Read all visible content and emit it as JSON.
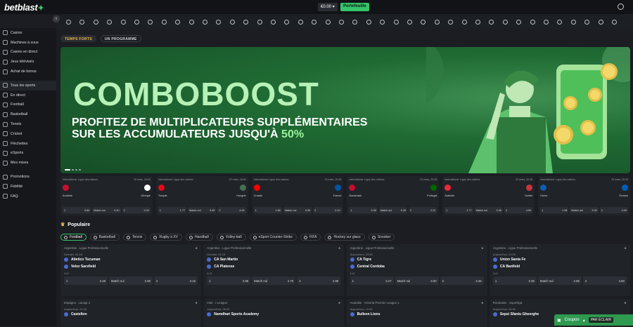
{
  "header": {
    "logo": "betblast",
    "balance": "€0.00",
    "wallet_label": "Portefeuille"
  },
  "sidebar": {
    "casino": [
      "Casino",
      "Machines à sous",
      "Casino en direct",
      "Jeux télévisés",
      "Achat de bonus"
    ],
    "sports": [
      "Tous les sports",
      "En direct",
      "Football",
      "Basketball",
      "Tennis",
      "Cricket",
      "Fléchettes",
      "eSports",
      "Mes mises"
    ],
    "other": [
      "Promotions",
      "Fidélité",
      "FAQ"
    ]
  },
  "tabs": [
    "TEMPS FORTS",
    "UN PROGRAMME"
  ],
  "banner": {
    "title": "COMBOBOOST",
    "line1": "PROFITEZ DE MULTIPLICATEURS SUPPLÉMENTAIRES",
    "line2": "SUR LES ACCUMULATEURS JUSQU'À ",
    "highlight": "50%"
  },
  "matches": [
    {
      "league": "International. Ligue des nations",
      "time": "20 mars, 18:00",
      "home": "Arménie",
      "away": "Géorgie",
      "o1": "3.80",
      "ox": "3.40",
      "o2": "2.02",
      "c1": "#c8102e",
      "c2": "#ffffff"
    },
    {
      "league": "International. Ligue des nations",
      "time": "20 mars, 18:00",
      "home": "Turquie",
      "away": "Hongrie",
      "o1": "1.77",
      "ox": "3.45",
      "o2": "4.00",
      "c1": "#e30a17",
      "c2": "#477050"
    },
    {
      "league": "International. Ligue des nations",
      "time": "20 mars, 20:45",
      "home": "Croatie",
      "away": "France",
      "o1": "2.80",
      "ox": "3.30",
      "o2": "2.10",
      "c1": "#ff0000",
      "c2": "#0055a4"
    },
    {
      "league": "International. Ligue des nations",
      "time": "20 mars, 20:45",
      "home": "Danemark",
      "away": "Portugal",
      "o1": "3.35",
      "ox": "3.25",
      "o2": "2.22",
      "c1": "#c60c30",
      "c2": "#006600"
    },
    {
      "league": "International. Ligue des nations",
      "time": "20 mars, 20:45",
      "home": "Autriche",
      "away": "Serbie",
      "o1": "1.77",
      "ox": "3.45",
      "o2": "4.90",
      "c1": "#ed2939",
      "c2": "#c6363c"
    },
    {
      "league": "International. Ligue des nations",
      "time": "20 mars, 20:45",
      "home": "Grèce",
      "away": "Écosse",
      "o1": "1.98",
      "ox": "3.30",
      "o2": "4.00",
      "c1": "#0d5eaf",
      "c2": "#005eb8"
    }
  ],
  "match_labels": {
    "draw": "Match nul",
    "one": "1",
    "two": "2"
  },
  "popular": {
    "title": "Populaire",
    "filters": [
      "Football",
      "Basketball",
      "Tennis",
      "Rugby à XV",
      "Handball",
      "Volley-ball",
      "eSport Counter-Strike",
      "FIFA",
      "Hockey sur glace",
      "Snooker"
    ]
  },
  "events": [
    {
      "league": "Argentine . Ligue Professionnelle",
      "time": "Demain, 01:15",
      "home": "Atletico Tucuman",
      "away": "Velez Sarsfield",
      "market": "1×2",
      "o1": "2.48",
      "ox": "2.85",
      "o2": "3.15"
    },
    {
      "league": "Argentine . Ligue Professionnelle",
      "time": "Demain, 01:15",
      "home": "CA San Martin",
      "away": "CA Platense",
      "market": "1×2",
      "o1": "2.85",
      "ox": "2.70",
      "o2": "2.90"
    },
    {
      "league": "Argentine . Ligue Professionnelle",
      "time": "Aujourd'hui, 23:00",
      "home": "CA Tigre",
      "away": "Central Cordoba",
      "market": "1×2",
      "o1": "2.27",
      "ox": "3.00",
      "o2": "3.45"
    },
    {
      "league": "Argentine . Ligue Professionnelle",
      "time": "Aujourd'hui, 23:00",
      "home": "Union Santa Fe",
      "away": "CA Banfield",
      "market": "1×2",
      "o1": "2.05",
      "ox": "2.85",
      "o2": "4.60"
    },
    {
      "league": "Espagne . LaLiga 2",
      "time": "Aujourd'hui, 21:00",
      "home": "Castellon",
      "away": "",
      "market": "",
      "o1": "",
      "ox": "",
      "o2": ""
    },
    {
      "league": "Inde . I-League",
      "time": "Aujourd'hui, 09:00",
      "home": "Namdhari Sports Academy",
      "away": "",
      "market": "",
      "o1": "",
      "ox": "",
      "o2": ""
    },
    {
      "league": "Australie . Victoria Premier League 1",
      "time": "Aujourd'hui, 10:30",
      "home": "Bulleen Lions",
      "away": "",
      "market": "",
      "o1": "",
      "ox": "",
      "o2": ""
    },
    {
      "league": "Roumanie . Superliga",
      "time": "Aujourd'hui, 18:00",
      "home": "Sepsi Sfantu Gheorghe",
      "away": "",
      "market": "",
      "o1": "",
      "ox": "",
      "o2": ""
    }
  ],
  "coupon": {
    "label": "Coupon",
    "badge": "PAR ÉCLAIR"
  }
}
